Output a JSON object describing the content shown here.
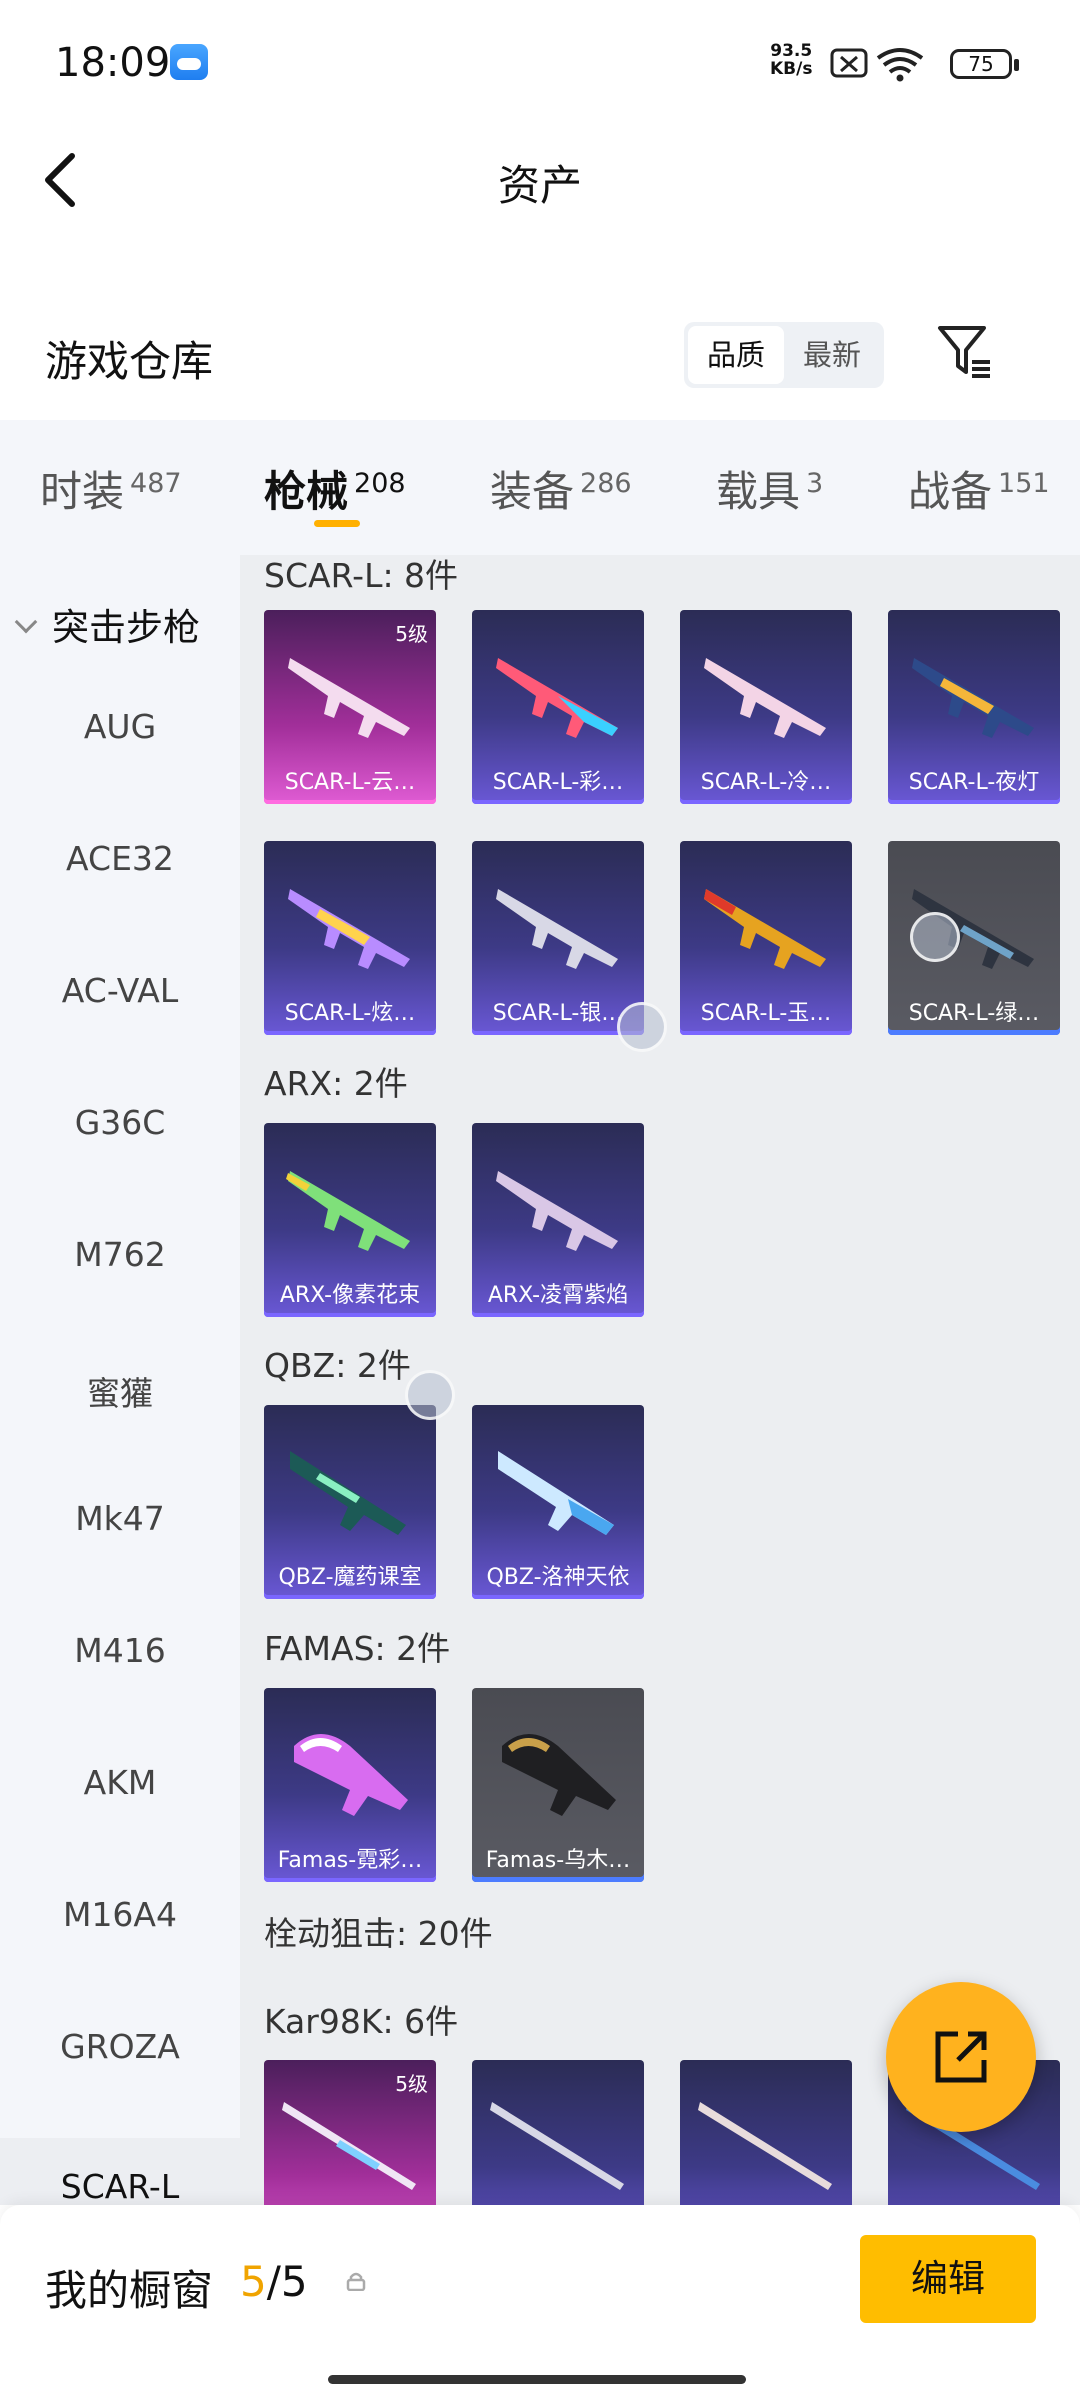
{
  "status": {
    "time": "18:09",
    "net_speed_value": "93.5",
    "net_speed_unit": "KB/s",
    "battery": "75"
  },
  "header": {
    "title": "资产"
  },
  "warehouse": {
    "title": "游戏仓库",
    "sort_quality": "品质",
    "sort_newest": "最新"
  },
  "tabs": [
    {
      "label": "时装",
      "count": "487"
    },
    {
      "label": "枪械",
      "count": "208"
    },
    {
      "label": "装备",
      "count": "286"
    },
    {
      "label": "载具",
      "count": "3"
    },
    {
      "label": "战备",
      "count": "151"
    }
  ],
  "sidebar": {
    "category": "突击步枪",
    "items": [
      "AUG",
      "ACE32",
      "AC-VAL",
      "G36C",
      "M762",
      "蜜獾",
      "Mk47",
      "M416",
      "AKM",
      "M16A4",
      "GROZA",
      "SCAR-L"
    ]
  },
  "groups": {
    "scar": "SCAR-L: 8件",
    "arx": "ARX: 2件",
    "qbz": "QBZ: 2件",
    "famas": "FAMAS: 2件",
    "bolt": "栓动狙击: 20件",
    "kar": "Kar98K: 6件"
  },
  "cards": {
    "scar": [
      "SCAR-L-云…",
      "SCAR-L-彩…",
      "SCAR-L-冷…",
      "SCAR-L-夜灯",
      "SCAR-L-炫…",
      "SCAR-L-银…",
      "SCAR-L-玉…",
      "SCAR-L-绿…"
    ],
    "arx": [
      "ARX-像素花束",
      "ARX-凌霄紫焰"
    ],
    "qbz": [
      "QBZ-魔药课室",
      "QBZ-洛神天依"
    ],
    "famas": [
      "Famas-霓彩…",
      "Famas-乌木…"
    ],
    "level_badge": "5级"
  },
  "bottom": {
    "my_window": "我的橱窗",
    "current": "5",
    "total": "/5",
    "edit": "编辑"
  },
  "colors": {
    "accent": "#ffbd00",
    "card_purple": "#3d3a86",
    "card_pink": "#a22f9a"
  }
}
